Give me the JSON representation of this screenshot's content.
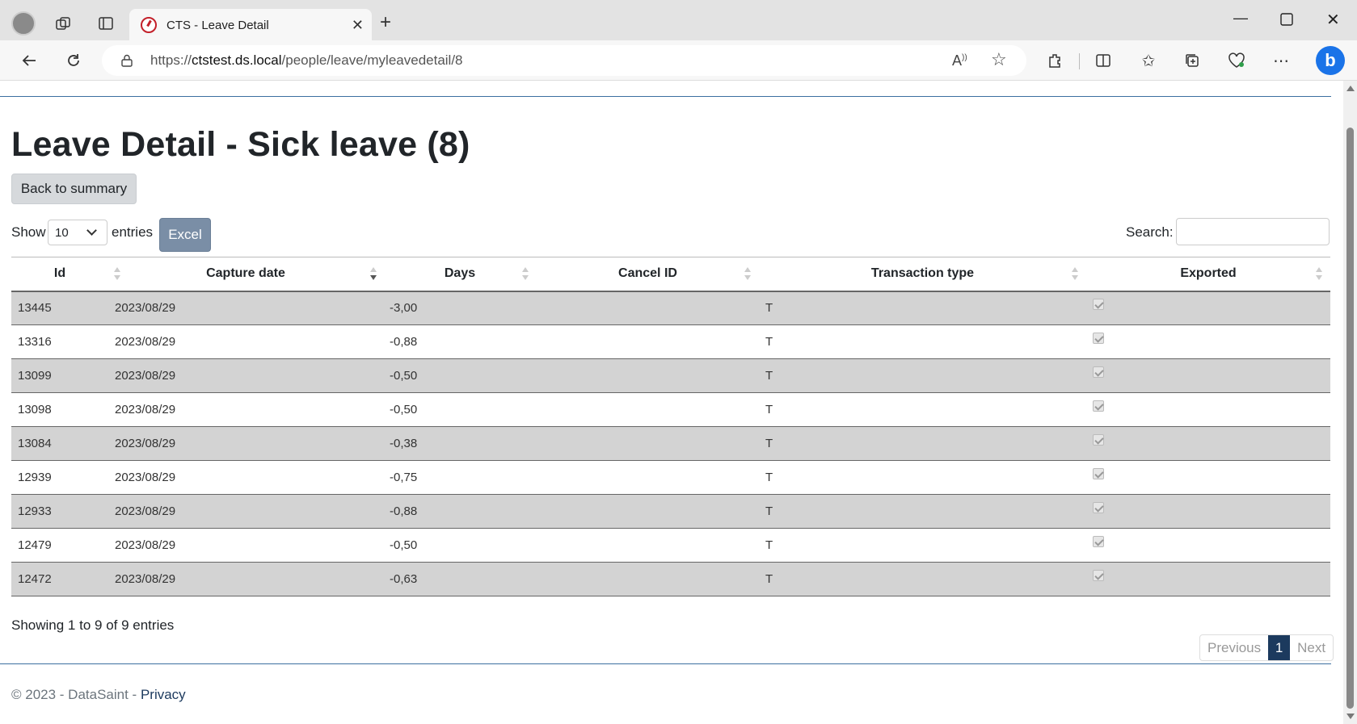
{
  "browser": {
    "tab_title": "CTS - Leave Detail",
    "url_scheme": "https://",
    "url_host": "ctstest.ds.local",
    "url_path": "/people/leave/myleavedetail/8"
  },
  "page": {
    "title": "Leave Detail - Sick leave (8)",
    "back_button": "Back to summary",
    "show_label": "Show",
    "entries_value": "10",
    "entries_label": "entries",
    "excel_button": "Excel",
    "search_label": "Search:",
    "search_value": ""
  },
  "table": {
    "columns": [
      "Id",
      "Capture date",
      "Days",
      "Cancel ID",
      "Transaction type",
      "Exported"
    ],
    "sorted_column": "Capture date",
    "sort_direction": "desc",
    "rows": [
      {
        "id": "13445",
        "date": "2023/08/29",
        "days": "-3,00",
        "cancel": "",
        "type": "T",
        "exported": true
      },
      {
        "id": "13316",
        "date": "2023/08/29",
        "days": "-0,88",
        "cancel": "",
        "type": "T",
        "exported": true
      },
      {
        "id": "13099",
        "date": "2023/08/29",
        "days": "-0,50",
        "cancel": "",
        "type": "T",
        "exported": true
      },
      {
        "id": "13098",
        "date": "2023/08/29",
        "days": "-0,50",
        "cancel": "",
        "type": "T",
        "exported": true
      },
      {
        "id": "13084",
        "date": "2023/08/29",
        "days": "-0,38",
        "cancel": "",
        "type": "T",
        "exported": true
      },
      {
        "id": "12939",
        "date": "2023/08/29",
        "days": "-0,75",
        "cancel": "",
        "type": "T",
        "exported": true
      },
      {
        "id": "12933",
        "date": "2023/08/29",
        "days": "-0,88",
        "cancel": "",
        "type": "T",
        "exported": true
      },
      {
        "id": "12479",
        "date": "2023/08/29",
        "days": "-0,50",
        "cancel": "",
        "type": "T",
        "exported": true
      },
      {
        "id": "12472",
        "date": "2023/08/29",
        "days": "-0,63",
        "cancel": "",
        "type": "T",
        "exported": true
      }
    ]
  },
  "pagination": {
    "info": "Showing 1 to 9 of 9 entries",
    "previous": "Previous",
    "current": "1",
    "next": "Next"
  },
  "footer": {
    "copyright": "© 2023 - DataSaint - ",
    "privacy_link": "Privacy"
  },
  "icons": [
    "profile-icon",
    "workspaces-icon",
    "tab-actions-icon",
    "site-favicon",
    "close-tab-icon",
    "new-tab-icon",
    "minimize-icon",
    "maximize-icon",
    "close-window-icon",
    "back-icon",
    "refresh-icon",
    "lock-icon",
    "read-aloud-icon",
    "favorite-star-icon",
    "extensions-icon",
    "split-screen-icon",
    "favorites-icon",
    "collections-icon",
    "browser-essentials-icon",
    "more-icon",
    "bing-icon"
  ]
}
